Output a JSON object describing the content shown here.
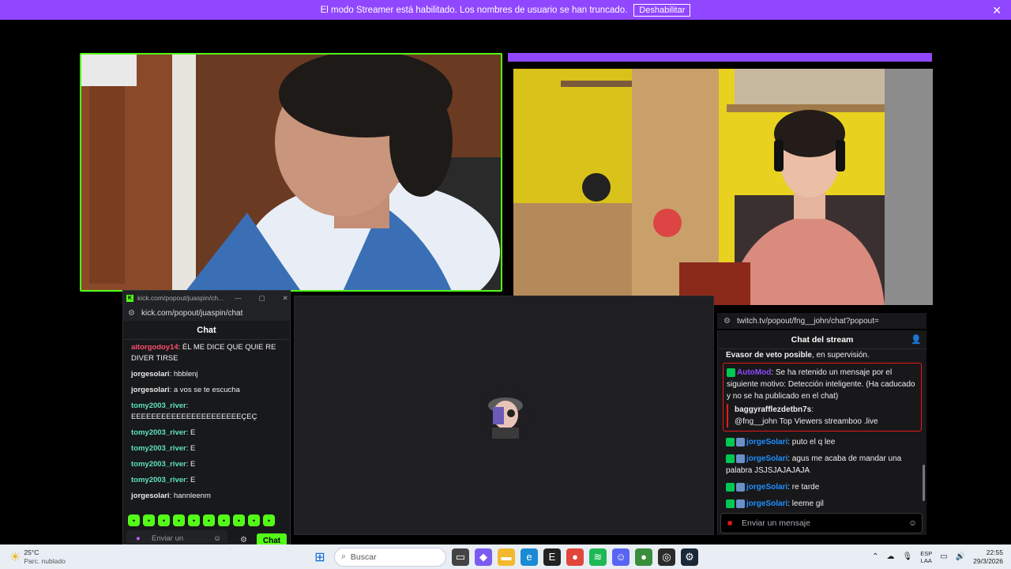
{
  "banner": {
    "text": "El modo Streamer está habilitado. Los nombres de usuario se han truncado.",
    "button": "Deshabilitar",
    "close": "✕"
  },
  "kick_window": {
    "title": "kick.com/popout/juaspin/ch...",
    "url": "kick.com/popout/juaspin/chat",
    "chat_title": "Chat",
    "messages": [
      {
        "user": "aitorgodoy14",
        "text": ": ÉL ME DICE QUE QUIE RE DIVER TIRSE",
        "color": "#ff4d6d"
      },
      {
        "user": "jorgesolari",
        "text": ": hbblenj",
        "color": "#e8e8e8"
      },
      {
        "user": "jorgesolari",
        "text": ": a vos se te escucha",
        "color": "#e8e8e8"
      },
      {
        "user": "tomy2003_river",
        "text": ": EEEEEEEEEEEEEEEEEEEEEEÇEÇ",
        "color": "#5ee3c0"
      },
      {
        "user": "tomy2003_river",
        "text": ": E",
        "color": "#5ee3c0"
      },
      {
        "user": "tomy2003_river",
        "text": ": E",
        "color": "#5ee3c0"
      },
      {
        "user": "tomy2003_river",
        "text": ": E",
        "color": "#5ee3c0"
      },
      {
        "user": "tomy2003_river",
        "text": ": E",
        "color": "#5ee3c0"
      },
      {
        "user": "jorgesolari",
        "text": ": hannleenm",
        "color": "#e8e8e8"
      }
    ],
    "input_placeholder": "Enviar un",
    "send_label": "Chat"
  },
  "twitch_window": {
    "url": "twitch.tv/popout/fng__john/chat?popout=",
    "chat_title": "Chat del stream",
    "evasor_text": "Evasor de veto posible",
    "evasor_suffix": ", en supervisión.",
    "automod_user": "AutoMod",
    "automod_text": ": Se ha retenido un mensaje por el siguiente motivo: Detección inteligente. (Ha caducado y no se ha publicado en el chat)",
    "held_user": "baggyrafflezdetbn7s",
    "held_text": "@fng__john Top Viewers streamboo .live",
    "messages": [
      {
        "user": "jorgeSolari",
        "text": ": puto el q lee"
      },
      {
        "user": "jorgeSolari",
        "text": ": agus me acaba de mandar una palabra JSJSJAJAJAJA"
      },
      {
        "user": "jorgeSolari",
        "text": ": re tarde"
      },
      {
        "user": "jorgeSolari",
        "text": ": leeme gil"
      }
    ],
    "input_placeholder": "Enviar un mensaje"
  },
  "taskbar": {
    "weather_temp": "25°C",
    "weather_desc": "Parc. nublado",
    "search_placeholder": "Buscar",
    "lang_top": "ESP",
    "lang_bottom": "LAA",
    "time": "22:55",
    "date": "29/3/2026"
  },
  "colors": {
    "twitch_purple": "#9147ff",
    "kick_green": "#53fc18",
    "twitch_user": "#1e90ff",
    "automod": "#9147ff"
  }
}
